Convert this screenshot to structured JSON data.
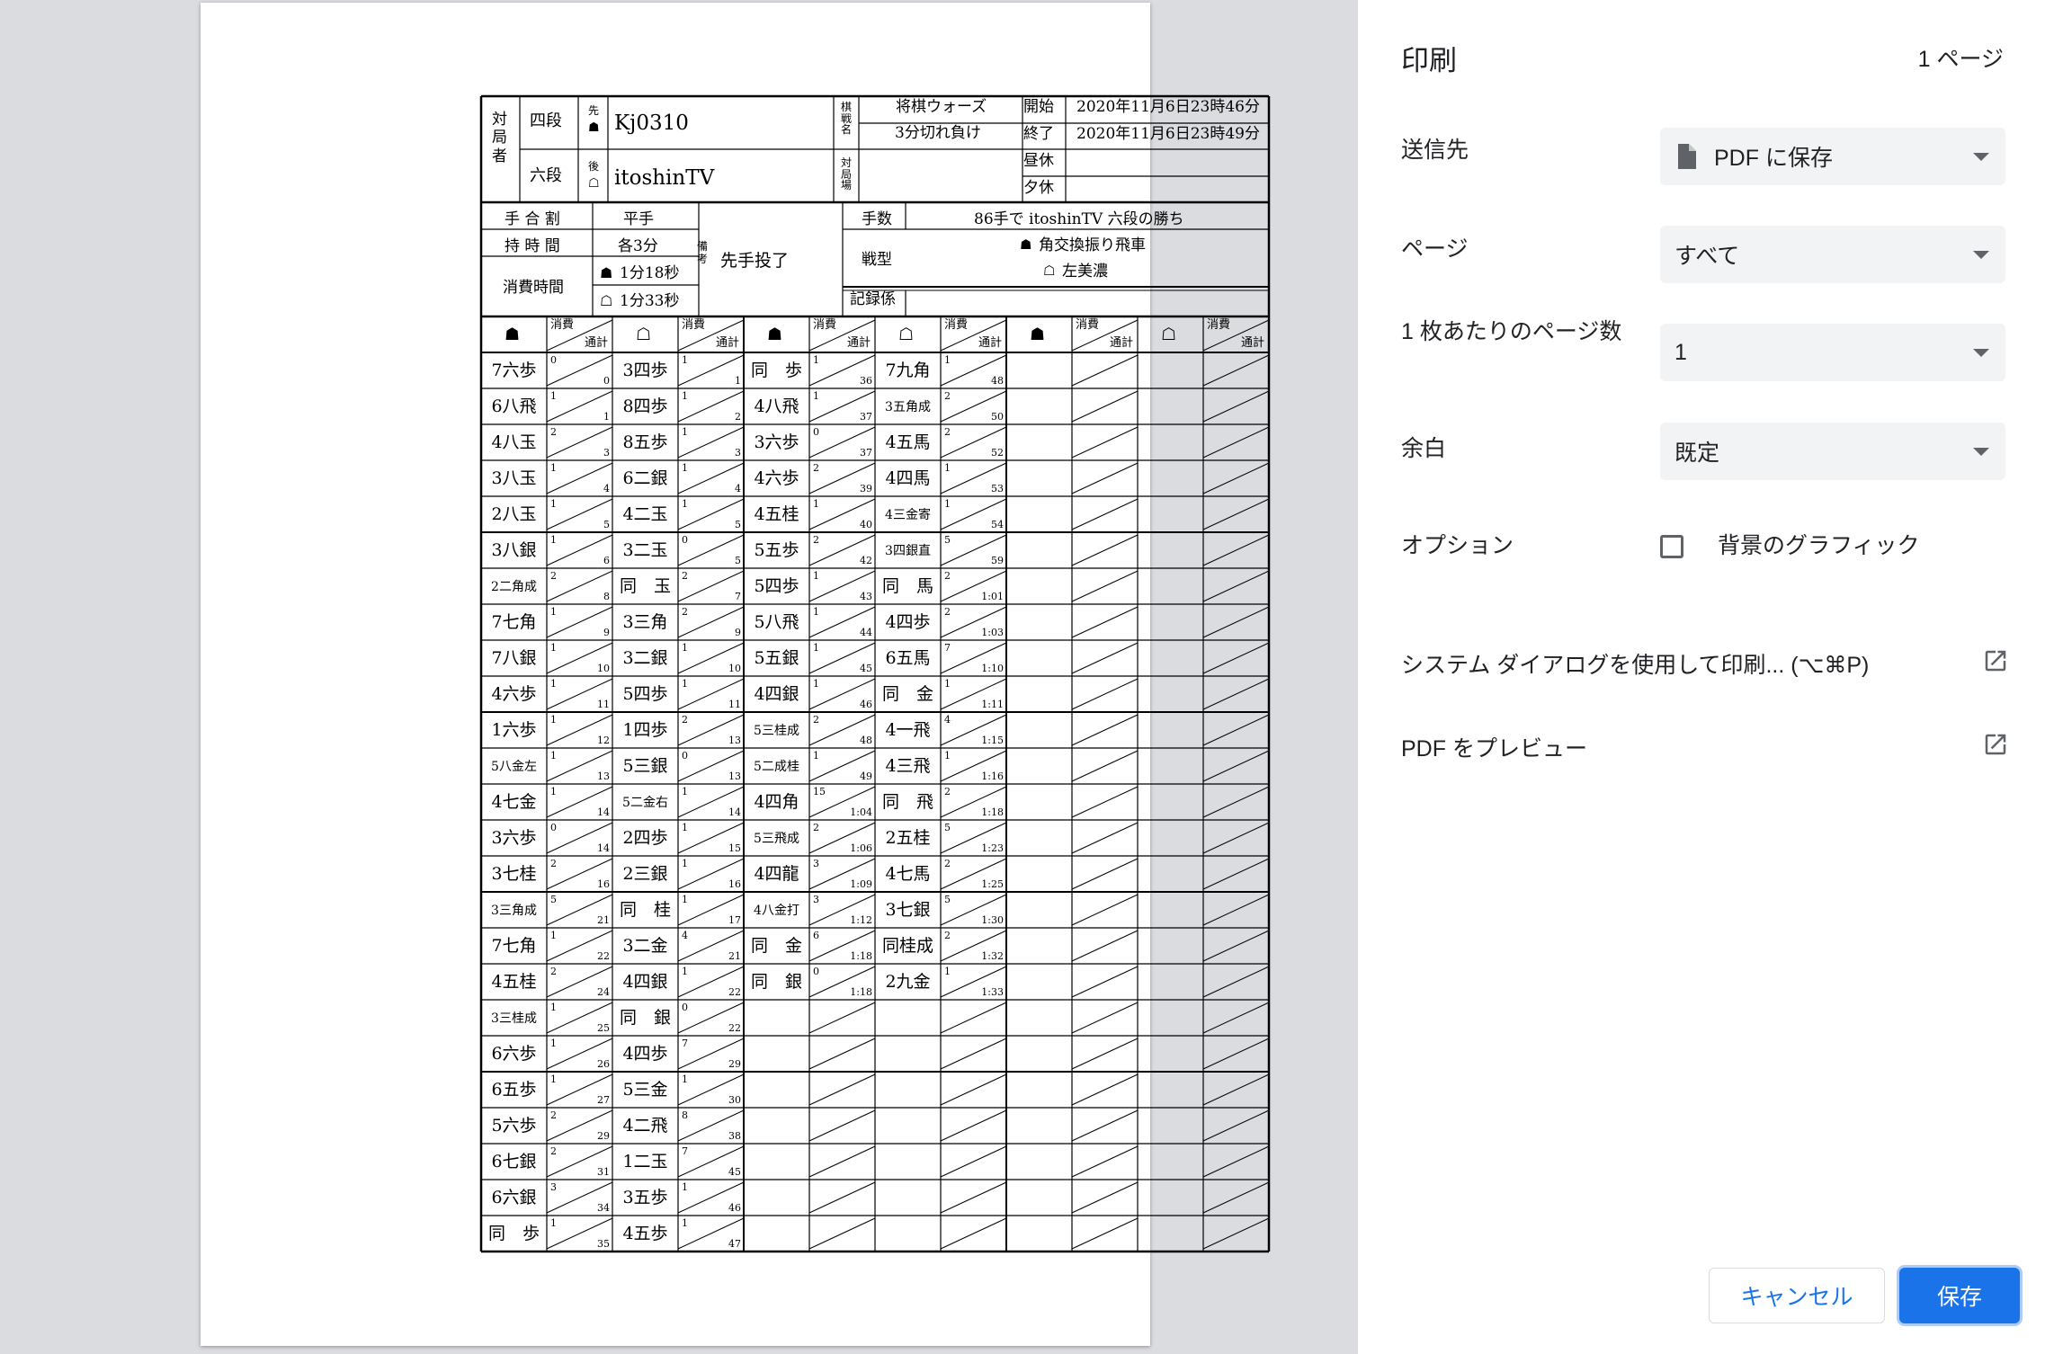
{
  "panel": {
    "title": "印刷",
    "page_count": "1 ページ",
    "destination_label": "送信先",
    "destination_value": "PDF に保存",
    "pages_label": "ページ",
    "pages_value": "すべて",
    "pages_per_sheet_label": "1 枚あたりのページ数",
    "pages_per_sheet_value": "1",
    "margins_label": "余白",
    "margins_value": "既定",
    "options_label": "オプション",
    "background_graphics_label": "背景のグラフィック",
    "background_graphics_checked": false,
    "system_dialog_link": "システム ダイアログを使用して印刷... (⌥⌘P)",
    "pdf_preview_link": "PDF をプレビュー",
    "cancel_label": "キャンセル",
    "save_label": "保存",
    "accent_color": "#1a73e8"
  },
  "kifu": {
    "header": {
      "players_label": "対局者",
      "sente_rank": "四段",
      "sente_mark": "先",
      "sente_name": "Kj0310",
      "gote_rank": "六段",
      "gote_mark": "後",
      "gote_name": "itoshinTV",
      "event_label": "棋戦名",
      "event_value": "将棋ウォーズ",
      "event_sub": "3分切れ負け",
      "venue_label": "対局場",
      "start_label": "開始",
      "start_value": "2020年11月6日23時46分",
      "end_label": "終了",
      "end_value": "2020年11月6日23時49分",
      "lunch_label": "昼休",
      "dinner_label": "夕休",
      "handicap_label": "手 合 割",
      "handicap_value": "平手",
      "time_label": "持 時 間",
      "time_value": "各3分",
      "used_label": "消費時間",
      "sente_used": "1分18秒",
      "gote_used": "1分33秒",
      "remarks_label": "備考",
      "remarks_value": "先手投了",
      "moves_label": "手数",
      "moves_value": "86手で itoshinTV 六段の勝ち",
      "strategy_label": "戦型",
      "sente_strategy": "角交換振り飛車",
      "gote_strategy": "左美濃",
      "recorder_label": "記録係",
      "col_used": "消費",
      "col_total": "通計"
    },
    "columns": [
      {
        "moves": [
          "7六歩",
          "6八飛",
          "4八玉",
          "3八玉",
          "2八玉",
          "3八銀",
          "2二角成",
          "7七角",
          "7八銀",
          "4六歩",
          "1六歩",
          "5八金左",
          "4七金",
          "3六歩",
          "3七桂",
          "3三角成",
          "7七角",
          "4五桂",
          "3三桂成",
          "6六歩",
          "6五歩",
          "5六歩",
          "6七銀",
          "6六銀",
          "同　歩"
        ],
        "used": [
          "0",
          "1",
          "2",
          "1",
          "1",
          "1",
          "2",
          "1",
          "1",
          "1",
          "1",
          "1",
          "1",
          "0",
          "2",
          "5",
          "1",
          "2",
          "1",
          "1",
          "1",
          "2",
          "2",
          "3",
          "1"
        ],
        "total": [
          "0",
          "1",
          "3",
          "4",
          "5",
          "6",
          "8",
          "9",
          "10",
          "11",
          "12",
          "13",
          "14",
          "14",
          "16",
          "21",
          "22",
          "24",
          "25",
          "26",
          "27",
          "29",
          "31",
          "34",
          "35"
        ]
      },
      {
        "moves": [
          "3四歩",
          "8四歩",
          "8五歩",
          "6二銀",
          "4二玉",
          "3二玉",
          "同　玉",
          "3三角",
          "3二銀",
          "5四歩",
          "1四歩",
          "5三銀",
          "5二金右",
          "2四歩",
          "2三銀",
          "同　桂",
          "3二金",
          "4四銀",
          "同　銀",
          "4四歩",
          "5三金",
          "4二飛",
          "1二玉",
          "3五歩",
          "4五歩"
        ],
        "used": [
          "1",
          "1",
          "1",
          "1",
          "1",
          "0",
          "2",
          "2",
          "1",
          "1",
          "2",
          "0",
          "1",
          "1",
          "1",
          "1",
          "4",
          "1",
          "0",
          "7",
          "1",
          "8",
          "7",
          "1",
          "1"
        ],
        "total": [
          "1",
          "2",
          "3",
          "4",
          "5",
          "5",
          "7",
          "9",
          "10",
          "11",
          "13",
          "13",
          "14",
          "15",
          "16",
          "17",
          "21",
          "22",
          "22",
          "29",
          "30",
          "38",
          "45",
          "46",
          "47"
        ]
      },
      {
        "moves": [
          "同　歩",
          "4八飛",
          "3六歩",
          "4六歩",
          "4五桂",
          "5五歩",
          "5四歩",
          "5八飛",
          "5五銀",
          "4四銀",
          "5三桂成",
          "5二成桂",
          "4四角",
          "5三飛成",
          "4四龍",
          "4八金打",
          "同　金",
          "同　銀"
        ],
        "used": [
          "1",
          "1",
          "0",
          "2",
          "1",
          "2",
          "1",
          "1",
          "1",
          "1",
          "2",
          "1",
          "15",
          "2",
          "3",
          "3",
          "6",
          "0"
        ],
        "total": [
          "36",
          "37",
          "37",
          "39",
          "40",
          "42",
          "43",
          "44",
          "45",
          "46",
          "48",
          "49",
          "1:04",
          "1:06",
          "1:09",
          "1:12",
          "1:18",
          "1:18"
        ]
      },
      {
        "moves": [
          "7九角",
          "3五角成",
          "4五馬",
          "4四馬",
          "4三金寄",
          "3四銀直",
          "同　馬",
          "4四歩",
          "6五馬",
          "同　金",
          "4一飛",
          "4三飛",
          "同　飛",
          "2五桂",
          "4七馬",
          "3七銀",
          "同桂成",
          "2九金"
        ],
        "used": [
          "1",
          "2",
          "2",
          "1",
          "1",
          "5",
          "2",
          "2",
          "7",
          "1",
          "4",
          "1",
          "2",
          "5",
          "2",
          "5",
          "2",
          "1"
        ],
        "total": [
          "48",
          "50",
          "52",
          "53",
          "54",
          "59",
          "1:01",
          "1:03",
          "1:10",
          "1:11",
          "1:15",
          "1:16",
          "1:18",
          "1:23",
          "1:25",
          "1:30",
          "1:32",
          "1:33"
        ]
      }
    ]
  }
}
